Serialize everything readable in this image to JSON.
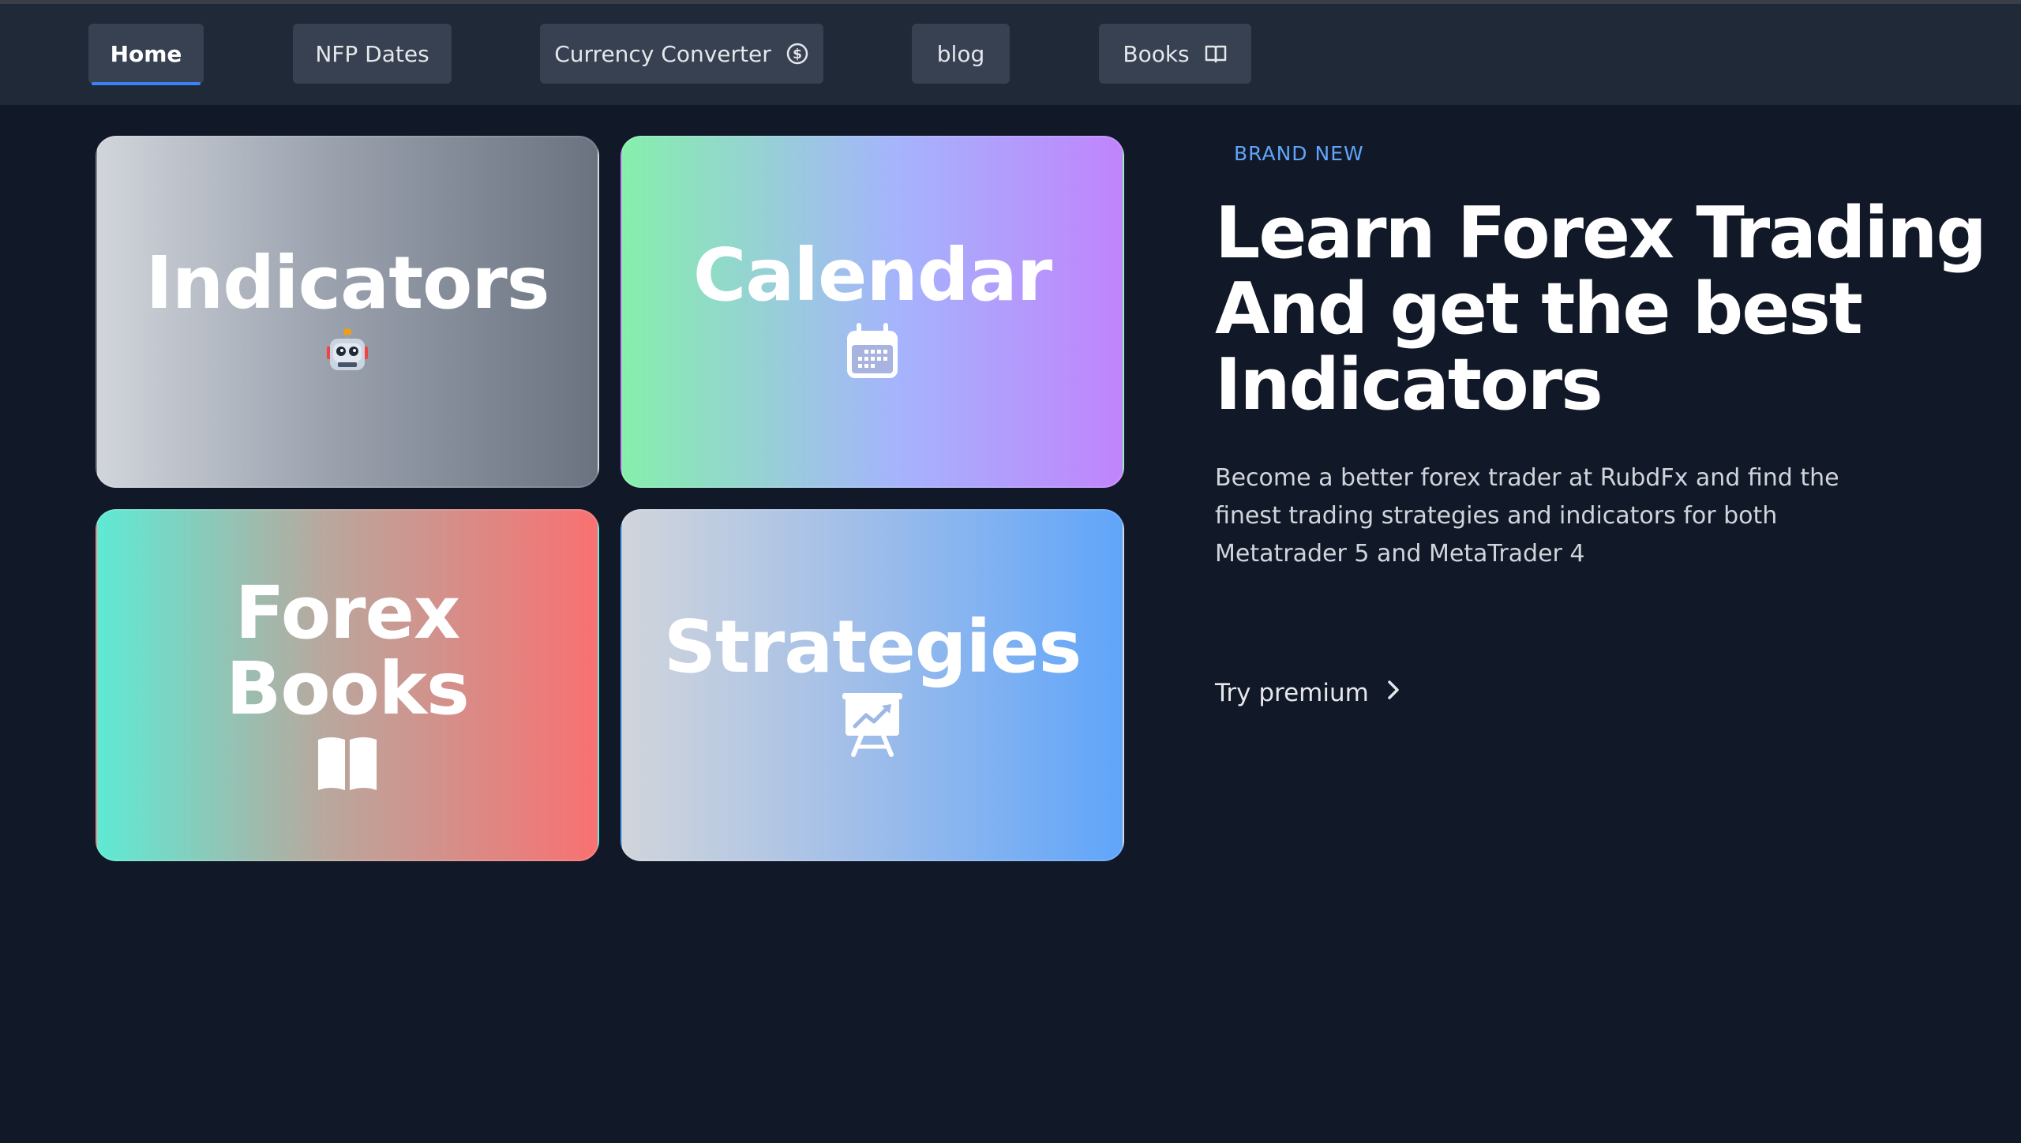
{
  "nav": {
    "items": [
      {
        "label": "Home",
        "active": true
      },
      {
        "label": "NFP Dates"
      },
      {
        "label": "Currency Converter",
        "icon": "dollar-circle-icon"
      },
      {
        "label": "blog"
      },
      {
        "label": "Books",
        "icon": "open-book-icon"
      }
    ]
  },
  "cards": [
    {
      "title": "Indicators",
      "icon": "robot-icon"
    },
    {
      "title": "Calendar",
      "icon": "calendar-icon"
    },
    {
      "title": "Forex Books",
      "icon": "open-book-icon"
    },
    {
      "title": "Strategies",
      "icon": "presentation-chart-icon"
    }
  ],
  "hero": {
    "eyebrow": "BRAND NEW",
    "headline": "Learn Forex Trading And get the best Indicators",
    "description": "Become a better forex trader at RubdFx and find the finest trading strategies and indicators for both Metatrader 5 and MetaTrader 4",
    "cta": "Try premium"
  },
  "colors": {
    "background": "#111827",
    "nav_background": "#1f2937",
    "nav_button": "#374151",
    "accent": "#3b82f6",
    "eyebrow": "#60a5fa"
  }
}
